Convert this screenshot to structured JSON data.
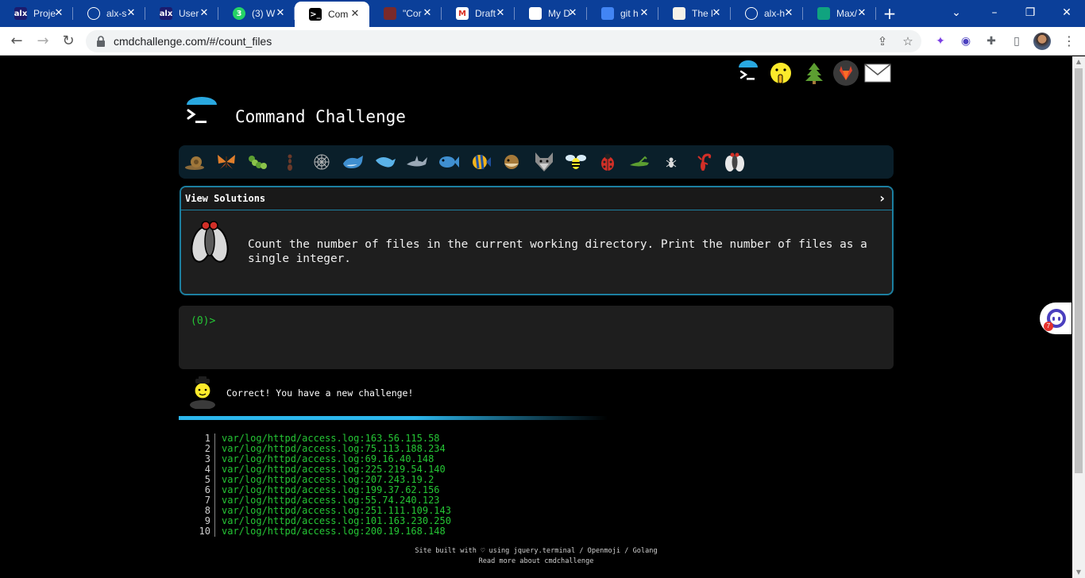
{
  "browser": {
    "tabs": [
      {
        "label": "Proje",
        "favicon": "alx-logo",
        "fav_text": "alx"
      },
      {
        "label": "alx-s",
        "favicon": "github-icon",
        "fav_text": ""
      },
      {
        "label": "User",
        "favicon": "alx-logo",
        "fav_text": "alx"
      },
      {
        "label": "(3) W",
        "favicon": "whatsapp-icon",
        "fav_text": "3"
      },
      {
        "label": "Com",
        "favicon": "terminal-icon",
        "fav_text": ">_",
        "active": true
      },
      {
        "label": "\"Cor",
        "favicon": "app-icon",
        "fav_text": ""
      },
      {
        "label": "Draft",
        "favicon": "gmail-icon",
        "fav_text": "M"
      },
      {
        "label": "My D",
        "favicon": "drive-icon",
        "fav_text": ""
      },
      {
        "label": "git h",
        "favicon": "docs-icon",
        "fav_text": ""
      },
      {
        "label": "The l",
        "favicon": "book-icon",
        "fav_text": ""
      },
      {
        "label": "alx-h",
        "favicon": "github-icon",
        "fav_text": ""
      },
      {
        "label": "Max/",
        "favicon": "chatgpt-icon",
        "fav_text": ""
      }
    ],
    "new_tab": "+",
    "url": "cmdchallenge.com/#/count_files"
  },
  "page": {
    "site_title": "Command Challenge",
    "view_solutions": "View Solutions",
    "chevron": "›",
    "challenge_text": "Count the number of files in the current working directory. Print the number of files as a single integer.",
    "prompt": "(0)>",
    "status_message": "Correct! You have a new challenge!",
    "progress": 0.6,
    "output_lines": [
      {
        "num": "1",
        "text": "var/log/httpd/access.log:163.56.115.58"
      },
      {
        "num": "2",
        "text": "var/log/httpd/access.log:75.113.188.234"
      },
      {
        "num": "3",
        "text": "var/log/httpd/access.log:69.16.40.148"
      },
      {
        "num": "4",
        "text": "var/log/httpd/access.log:225.219.54.140"
      },
      {
        "num": "5",
        "text": "var/log/httpd/access.log:207.243.19.2"
      },
      {
        "num": "6",
        "text": "var/log/httpd/access.log:199.37.62.156"
      },
      {
        "num": "7",
        "text": "var/log/httpd/access.log:55.74.240.123"
      },
      {
        "num": "8",
        "text": "var/log/httpd/access.log:251.111.109.143"
      },
      {
        "num": "9",
        "text": "var/log/httpd/access.log:101.163.230.250"
      },
      {
        "num": "10",
        "text": "var/log/httpd/access.log:200.19.168.148"
      }
    ],
    "footer_line1": "Site built with ♡ using jquery.terminal / Openmoji / Golang",
    "footer_line2": "Read more about cmdchallenge",
    "chat_badge": "7"
  },
  "colors": {
    "accent": "#2cb6ec",
    "prompt_green": "#25c635",
    "card_border": "#1c7fa0",
    "browser_frame": "#0b3f99"
  }
}
